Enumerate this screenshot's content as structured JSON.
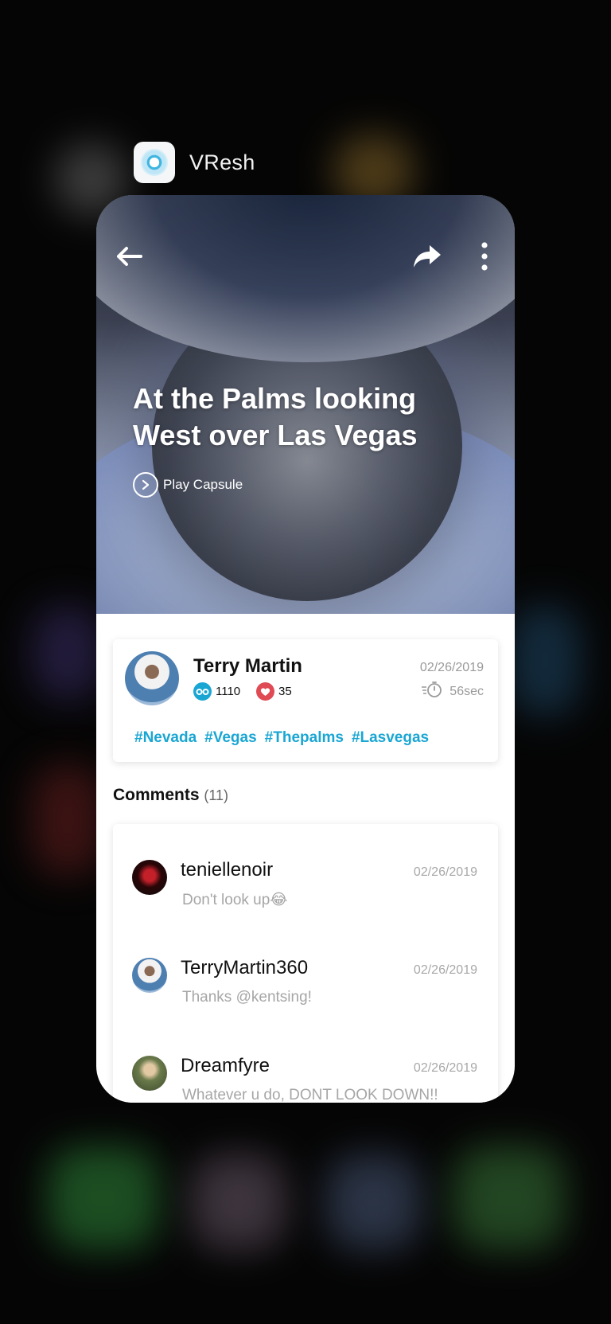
{
  "app": {
    "name": "VResh"
  },
  "hero": {
    "title": "At the Palms looking West over Las Vegas",
    "play_label": "Play Capsule"
  },
  "author": {
    "name": "Terry Martin",
    "views": "1110",
    "likes": "35",
    "date": "02/26/2019",
    "duration": "56sec",
    "tags": [
      "#Nevada",
      "#Vegas",
      "#Thepalms",
      "#Lasvegas"
    ]
  },
  "comments": {
    "heading": "Comments",
    "count": "(11)",
    "items": [
      {
        "user": "teniellenoir",
        "date": "02/26/2019",
        "text": "Don't look up😂"
      },
      {
        "user": "TerryMartin360",
        "date": "02/26/2019",
        "text": "Thanks @kentsing!"
      },
      {
        "user": "Dreamfyre",
        "date": "02/26/2019",
        "text": "Whatever u do, DONT LOOK DOWN!!"
      }
    ]
  },
  "colors": {
    "accent": "#1aa6d3",
    "likes": "#e04a54",
    "views": "#1aa6d3"
  }
}
